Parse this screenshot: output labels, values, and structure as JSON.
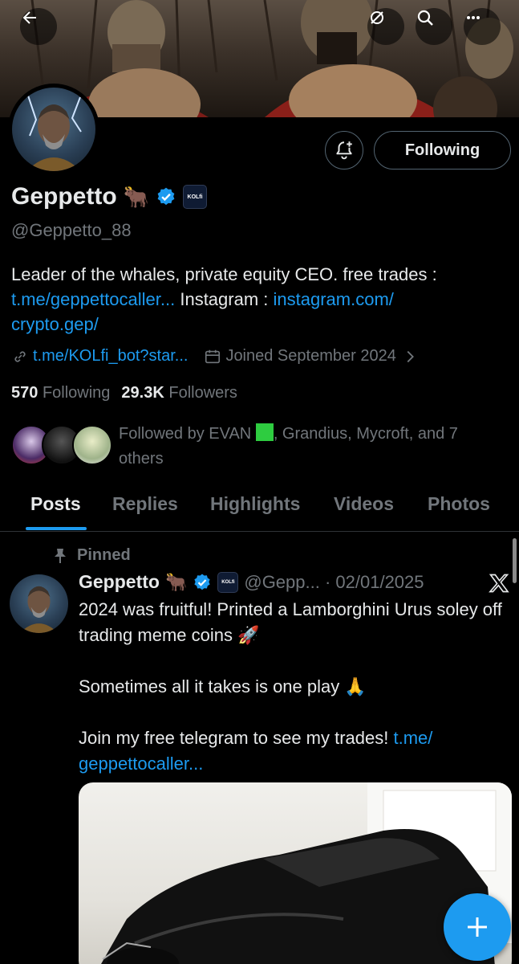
{
  "header": {
    "back_icon": "back-arrow-icon",
    "grok_icon": "grok-icon",
    "search_icon": "search-icon",
    "more_icon": "more-icon"
  },
  "profile": {
    "display_name": "Geppetto",
    "name_emoji": "🐂",
    "affiliate_badge": "KOLfi",
    "handle": "@Geppetto_88",
    "following_button": "Following",
    "bio_text_1": "Leader of the whales, private equity CEO. free trades : ",
    "bio_link_1": "t.me/geppettocaller...",
    "bio_text_2": " Instagram : ",
    "bio_link_2": "instagram.com/",
    "bio_link_2b": "crypto.gep/",
    "website": "t.me/KOLfi_bot?star...",
    "joined": "Joined September 2024",
    "following_count": "570",
    "following_label": "Following",
    "followers_count": "29.3K",
    "followers_label": "Followers",
    "followed_by_1": "Followed by EVAN ",
    "followed_by_2": ", Grandius, Mycroft, and 7 others"
  },
  "tabs": [
    "Posts",
    "Replies",
    "Highlights",
    "Videos",
    "Photos"
  ],
  "post": {
    "pinned_label": "Pinned",
    "author": "Geppetto",
    "emoji": "🐂",
    "badge": "KOLfi",
    "handle_date": "@Gepp... · 02/01/2025",
    "line1": "2024 was fruitful! Printed a Lamborghini Urus soley off trading meme coins 🚀",
    "line2": "Sometimes all it takes is one play 🙏",
    "line3_text": "Join my free telegram to see my trades! ",
    "line3_link": "t.me/ geppettocaller..."
  },
  "colors": {
    "accent": "#1d9bf0",
    "text": "#e7e9ea",
    "muted": "#71767b",
    "background": "#000000"
  }
}
